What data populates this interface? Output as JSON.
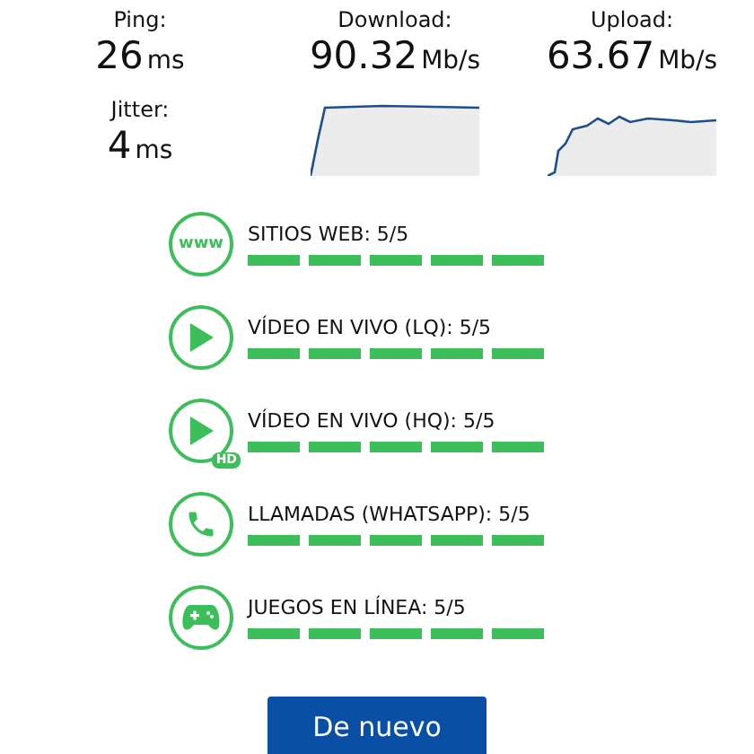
{
  "stats": [
    {
      "label": "Ping:",
      "value": "26",
      "unit": "ms"
    },
    {
      "label": "Download:",
      "value": "90.32",
      "unit": "Mb/s",
      "kind": "download"
    },
    {
      "label": "Upload:",
      "value": "63.67",
      "unit": "Mb/s",
      "kind": "upload"
    },
    {
      "label": "Jitter:",
      "value": "4",
      "unit": "ms"
    }
  ],
  "services": [
    {
      "kind": "web",
      "icon_text": "www",
      "label": "SITIOS WEB: 5/5",
      "stars": 5
    },
    {
      "kind": "video",
      "label": "VÍDEO EN VIVO (LQ): 5/5",
      "stars": 5
    },
    {
      "kind": "video",
      "badge": "HD",
      "label": "VÍDEO EN VIVO (HQ): 5/5",
      "stars": 5
    },
    {
      "kind": "call",
      "label": "LLAMADAS (WHATSAPP): 5/5",
      "stars": 5
    },
    {
      "kind": "game",
      "label": "JUEGOS EN LÍNEA: 5/5",
      "stars": 5
    }
  ],
  "button": "De nuevo"
}
